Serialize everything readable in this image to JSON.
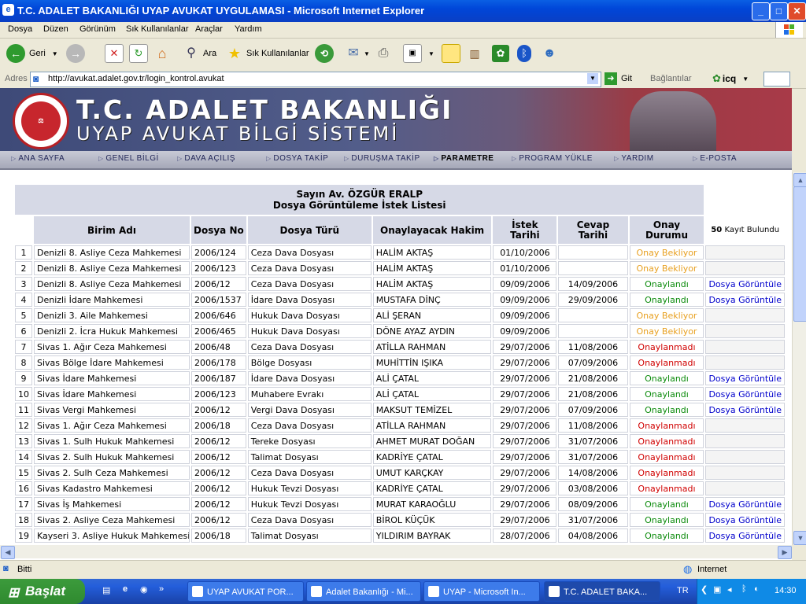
{
  "window": {
    "title": "T.C. ADALET BAKANLIĞI UYAP AVUKAT UYGULAMASI - Microsoft Internet Explorer",
    "min": "_",
    "max": "□",
    "close": "✕"
  },
  "menu": [
    "Dosya",
    "Düzen",
    "Görünüm",
    "Sık Kullanılanlar",
    "Araçlar",
    "Yardım"
  ],
  "toolbar": {
    "back": "Geri",
    "search": "Ara",
    "favorites": "Sık Kullanılanlar"
  },
  "address": {
    "label": "Adres",
    "url": "http://avukat.adalet.gov.tr/login_kontrol.avukat",
    "go": "Git",
    "links": "Bağlantılar",
    "icq": "icq"
  },
  "banner": {
    "title": "T.C. ADALET BAKANLIĞI",
    "subtitle": "UYAP AVUKAT BİLGİ SİSTEMİ",
    "seal_text": "ADALET BAKANLIĞI",
    "seal_top": "T.C."
  },
  "nav": [
    "ANA SAYFA",
    "GENEL BİLGİ",
    "DAVA AÇILIŞ",
    "DOSYA TAKİP",
    "DURUŞMA TAKİP",
    "PARAMETRE",
    "PROGRAM YÜKLE",
    "YARDIM",
    "E-POSTA"
  ],
  "list": {
    "greeting": "Sayın Av. ÖZGÜR ERALP",
    "heading": "Dosya Görüntüleme İstek Listesi",
    "count": "50",
    "count_label": "Kayıt Bulundu",
    "columns": [
      "Birim Adı",
      "Dosya No",
      "Dosya Türü",
      "Onaylayacak Hakim",
      "İstek Tarihi",
      "Cevap Tarihi",
      "Onay Durumu"
    ],
    "rows": [
      {
        "n": "1",
        "unit": "Denizli 8. Asliye Ceza Mahkemesi",
        "no": "2006/124",
        "type": "Ceza Dava Dosyası",
        "judge": "HALİM AKTAŞ",
        "req": "01/10/2006",
        "resp": "",
        "status": "Onay Bekliyor",
        "cls": "pend",
        "link": ""
      },
      {
        "n": "2",
        "unit": "Denizli 8. Asliye Ceza Mahkemesi",
        "no": "2006/123",
        "type": "Ceza Dava Dosyası",
        "judge": "HALİM AKTAŞ",
        "req": "01/10/2006",
        "resp": "",
        "status": "Onay Bekliyor",
        "cls": "pend",
        "link": ""
      },
      {
        "n": "3",
        "unit": "Denizli 8. Asliye Ceza Mahkemesi",
        "no": "2006/12",
        "type": "Ceza Dava Dosyası",
        "judge": "HALİM AKTAŞ",
        "req": "09/09/2006",
        "resp": "14/09/2006",
        "status": "Onaylandı",
        "cls": "ok",
        "link": "Dosya Görüntüle"
      },
      {
        "n": "4",
        "unit": "Denizli İdare Mahkemesi",
        "no": "2006/1537",
        "type": "İdare Dava Dosyası",
        "judge": "MUSTAFA DİNÇ",
        "req": "09/09/2006",
        "resp": "29/09/2006",
        "status": "Onaylandı",
        "cls": "ok",
        "link": "Dosya Görüntüle"
      },
      {
        "n": "5",
        "unit": "Denizli 3. Aile Mahkemesi",
        "no": "2006/646",
        "type": "Hukuk Dava Dosyası",
        "judge": "ALİ ŞERAN",
        "req": "09/09/2006",
        "resp": "",
        "status": "Onay Bekliyor",
        "cls": "pend",
        "link": ""
      },
      {
        "n": "6",
        "unit": "Denizli 2. İcra Hukuk Mahkemesi",
        "no": "2006/465",
        "type": "Hukuk Dava Dosyası",
        "judge": "DÖNE AYAZ AYDIN",
        "req": "09/09/2006",
        "resp": "",
        "status": "Onay Bekliyor",
        "cls": "pend",
        "link": ""
      },
      {
        "n": "7",
        "unit": "Sivas 1. Ağır Ceza Mahkemesi",
        "no": "2006/48",
        "type": "Ceza Dava Dosyası",
        "judge": "ATİLLA RAHMAN",
        "req": "29/07/2006",
        "resp": "11/08/2006",
        "status": "Onaylanmadı",
        "cls": "no",
        "link": ""
      },
      {
        "n": "8",
        "unit": "Sivas Bölge İdare Mahkemesi",
        "no": "2006/178",
        "type": "Bölge Dosyası",
        "judge": "MUHİTTİN IŞIKA",
        "req": "29/07/2006",
        "resp": "07/09/2006",
        "status": "Onaylanmadı",
        "cls": "no",
        "link": ""
      },
      {
        "n": "9",
        "unit": "Sivas İdare Mahkemesi",
        "no": "2006/187",
        "type": "İdare Dava Dosyası",
        "judge": "ALİ ÇATAL",
        "req": "29/07/2006",
        "resp": "21/08/2006",
        "status": "Onaylandı",
        "cls": "ok",
        "link": "Dosya Görüntüle"
      },
      {
        "n": "10",
        "unit": "Sivas İdare Mahkemesi",
        "no": "2006/123",
        "type": "Muhabere Evrakı",
        "judge": "ALİ ÇATAL",
        "req": "29/07/2006",
        "resp": "21/08/2006",
        "status": "Onaylandı",
        "cls": "ok",
        "link": "Dosya Görüntüle"
      },
      {
        "n": "11",
        "unit": "Sivas Vergi Mahkemesi",
        "no": "2006/12",
        "type": "Vergi Dava Dosyası",
        "judge": "MAKSUT TEMİZEL",
        "req": "29/07/2006",
        "resp": "07/09/2006",
        "status": "Onaylandı",
        "cls": "ok",
        "link": "Dosya Görüntüle"
      },
      {
        "n": "12",
        "unit": "Sivas 1. Ağır Ceza Mahkemesi",
        "no": "2006/18",
        "type": "Ceza Dava Dosyası",
        "judge": "ATİLLA RAHMAN",
        "req": "29/07/2006",
        "resp": "11/08/2006",
        "status": "Onaylanmadı",
        "cls": "no",
        "link": ""
      },
      {
        "n": "13",
        "unit": "Sivas 1. Sulh Hukuk Mahkemesi",
        "no": "2006/12",
        "type": "Tereke Dosyası",
        "judge": "AHMET MURAT DOĞAN",
        "req": "29/07/2006",
        "resp": "31/07/2006",
        "status": "Onaylanmadı",
        "cls": "no",
        "link": ""
      },
      {
        "n": "14",
        "unit": "Sivas 2. Sulh Hukuk Mahkemesi",
        "no": "2006/12",
        "type": "Talimat Dosyası",
        "judge": "KADRİYE ÇATAL",
        "req": "29/07/2006",
        "resp": "31/07/2006",
        "status": "Onaylanmadı",
        "cls": "no",
        "link": ""
      },
      {
        "n": "15",
        "unit": "Sivas 2. Sulh Ceza Mahkemesi",
        "no": "2006/12",
        "type": "Ceza Dava Dosyası",
        "judge": "UMUT KARÇKAY",
        "req": "29/07/2006",
        "resp": "14/08/2006",
        "status": "Onaylanmadı",
        "cls": "no",
        "link": ""
      },
      {
        "n": "16",
        "unit": "Sivas Kadastro Mahkemesi",
        "no": "2006/12",
        "type": "Hukuk Tevzi Dosyası",
        "judge": "KADRİYE ÇATAL",
        "req": "29/07/2006",
        "resp": "03/08/2006",
        "status": "Onaylanmadı",
        "cls": "no",
        "link": ""
      },
      {
        "n": "17",
        "unit": "Sivas İş Mahkemesi",
        "no": "2006/12",
        "type": "Hukuk Tevzi Dosyası",
        "judge": "MURAT KARAOĞLU",
        "req": "29/07/2006",
        "resp": "08/09/2006",
        "status": "Onaylandı",
        "cls": "ok",
        "link": "Dosya Görüntüle"
      },
      {
        "n": "18",
        "unit": "Sivas 2. Asliye Ceza Mahkemesi",
        "no": "2006/12",
        "type": "Ceza Dava Dosyası",
        "judge": "BİROL KÜÇÜK",
        "req": "29/07/2006",
        "resp": "31/07/2006",
        "status": "Onaylandı",
        "cls": "ok",
        "link": "Dosya Görüntüle"
      },
      {
        "n": "19",
        "unit": "Kayseri 3. Asliye Hukuk Mahkemesi",
        "no": "2006/18",
        "type": "Talimat Dosyası",
        "judge": "YILDIRIM BAYRAK",
        "req": "28/07/2006",
        "resp": "04/08/2006",
        "status": "Onaylandı",
        "cls": "ok",
        "link": "Dosya Görüntüle"
      }
    ]
  },
  "status": {
    "text": "Bitti",
    "zone": "Internet"
  },
  "taskbar": {
    "start": "Başlat",
    "tasks": [
      "UYAP AVUKAT POR...",
      "Adalet Bakanlığı - Mi...",
      "UYAP - Microsoft In...",
      "T.C. ADALET BAKA..."
    ],
    "lang": "TR",
    "clock": "14:30"
  },
  "colors": {
    "pending": "#e8a020",
    "approved": "#0a8a0a",
    "rejected": "#d00000",
    "link": "#0000cc"
  }
}
